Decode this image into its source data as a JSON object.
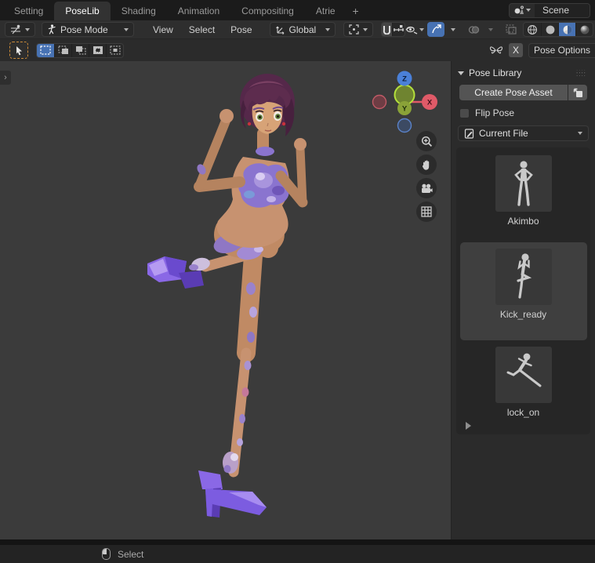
{
  "topbar": {
    "tabs": [
      {
        "label": "Setting",
        "active": false
      },
      {
        "label": "PoseLib",
        "active": true
      },
      {
        "label": "Shading",
        "active": false
      },
      {
        "label": "Animation",
        "active": false
      },
      {
        "label": "Compositing",
        "active": false
      },
      {
        "label": "Atrie",
        "active": false
      }
    ],
    "add_tab_label": "+",
    "scene": {
      "label": "Scene"
    }
  },
  "header": {
    "mode_label": "Pose Mode",
    "menus": [
      {
        "label": "View"
      },
      {
        "label": "Select"
      },
      {
        "label": "Pose"
      }
    ],
    "orientation_label": "Global"
  },
  "tool_header": {
    "mirror_x_label": "X",
    "pose_options_label": "Pose Options"
  },
  "viewport": {
    "gizmo": {
      "x": "X",
      "y": "Y",
      "z": "Z"
    },
    "shading_mode": "Material Preview"
  },
  "sidebar": {
    "panel_title": "Pose Library",
    "create_button_label": "Create Pose Asset",
    "flip_pose_label": "Flip Pose",
    "library_value": "Current File",
    "assets": [
      {
        "label": "Akimbo",
        "selected": false
      },
      {
        "label": "Kick_ready",
        "selected": true
      },
      {
        "label": "lock_on",
        "selected": false
      }
    ]
  },
  "statusbar": {
    "select_label": "Select"
  },
  "colors": {
    "accent_blue": "#4772b3",
    "viewport_bg": "#3b3b3b",
    "header_bg": "#2e2e2e",
    "panel_bg": "#2b2b2b",
    "axis_x_red": "#e05a68",
    "axis_y_green": "#8aa238",
    "axis_z_blue": "#4a80d8",
    "tool_dashed_orange": "#c98a39",
    "shoe_purple": "#7c5ce0",
    "hair_purple": "#55284a"
  },
  "icons": {
    "editor_type": "3d-viewport-icon",
    "mode": "pose-mode-icon",
    "snap": "magnet-icon",
    "visibility": "eye-icon",
    "nav": [
      "zoom-icon",
      "pan-hand-icon",
      "camera-icon",
      "grid-icon"
    ]
  }
}
